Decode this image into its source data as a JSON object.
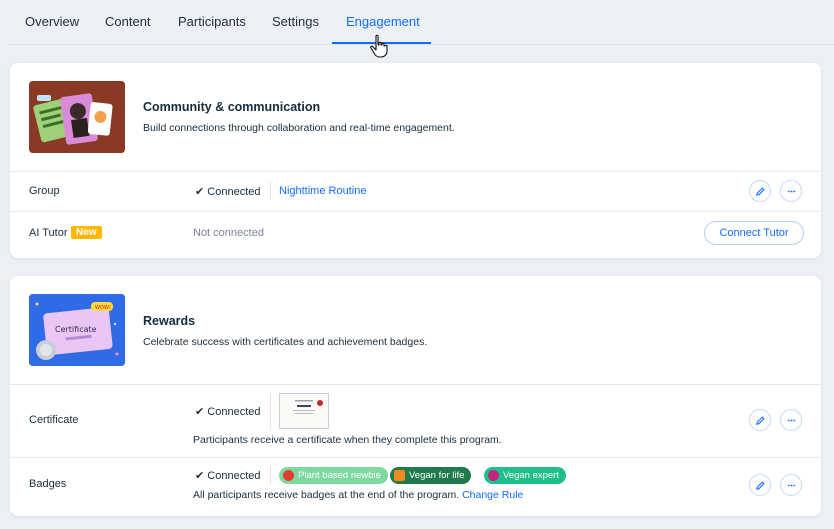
{
  "tabs": [
    {
      "label": "Overview"
    },
    {
      "label": "Content"
    },
    {
      "label": "Participants"
    },
    {
      "label": "Settings"
    },
    {
      "label": "Engagement",
      "active": true
    }
  ],
  "community": {
    "title": "Community & communication",
    "subtitle": "Build connections through collaboration and real-time engagement.",
    "group": {
      "label": "Group",
      "status": "✔ Connected",
      "link": "Nighttime Routine"
    },
    "ai_tutor": {
      "label": "AI Tutor",
      "badge": "New",
      "status": "Not connected",
      "button": "Connect Tutor"
    }
  },
  "rewards": {
    "title": "Rewards",
    "subtitle": "Celebrate success with certificates and achievement badges.",
    "thumb_text": "Certificate",
    "thumb_sticker": "WOW!",
    "certificate": {
      "label": "Certificate",
      "status": "✔ Connected",
      "description": "Participants receive a certificate when they complete this program."
    },
    "badges": {
      "label": "Badges",
      "status": "✔ Connected",
      "items": [
        {
          "label": "Plant based newbie",
          "color": "#7ed9a0",
          "icon_color": "#e23d2d"
        },
        {
          "label": "Vegan for life",
          "color": "#1f7a4d",
          "icon_color": "#f0891e"
        },
        {
          "label": "Vegan expert",
          "color": "#1fbf8c",
          "icon_color": "#c2267d"
        }
      ],
      "description": "All participants receive badges at the end of the program.",
      "change_rule": "Change Rule"
    }
  },
  "colors": {
    "accent": "#116dff",
    "new_badge": "#ffb700",
    "community_thumb_bg": "#8a3a24",
    "rewards_thumb_bg": "#2f6be6"
  }
}
